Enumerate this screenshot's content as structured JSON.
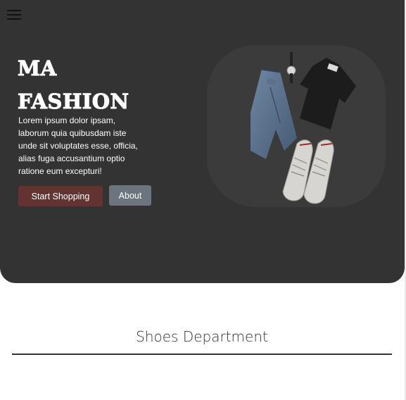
{
  "header": {
    "menu_icon": "hamburger-menu-icon"
  },
  "hero": {
    "brand_line1": "MA",
    "brand_line2": "FASHION",
    "text": "Lorem ipsum dolor ipsam, laborum quia quibusdam iste unde sit voluptates esse, officia, alias fuga accusantium optio ratione eum excepturi!",
    "primary_button": "Start Shopping",
    "secondary_button": "About",
    "image_subject": "flat-lay-outfit-photo"
  },
  "section": {
    "title": "Shoes Department"
  },
  "colors": {
    "hero_background": "#333333",
    "primary_button": "#633332",
    "secondary_button": "#6c757d",
    "page_background": "#ffffff"
  }
}
